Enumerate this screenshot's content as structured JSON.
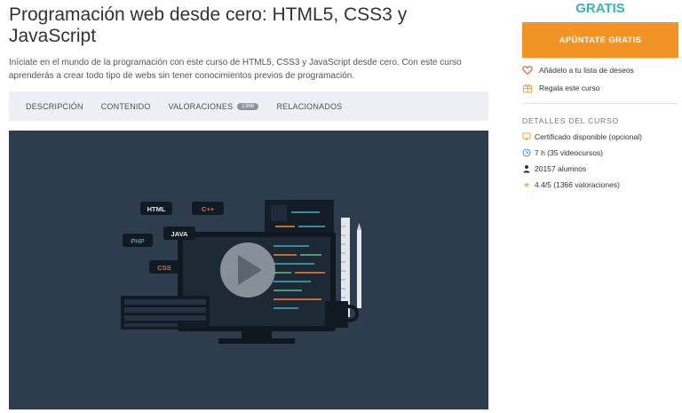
{
  "course": {
    "title": "Programación web desde cero: HTML5, CSS3 y JavaScript",
    "description": "Iníciate en el mundo de la programación con este curso de HTML5, CSS3 y JavaScript desde cero. Con este curso aprenderás a crear todo tipo de webs sin tener conocimientos previos de programación."
  },
  "tabs": [
    {
      "label": "Descripción"
    },
    {
      "label": "Contenido"
    },
    {
      "label": "Valoraciones",
      "badge": "1366"
    },
    {
      "label": "Relacionados"
    }
  ],
  "video": {
    "tags": [
      "HTML",
      "C++",
      "JAVA",
      "PHP",
      "CSS"
    ],
    "play_icon": "play-icon"
  },
  "sidebar": {
    "price": "GRATIS",
    "cta_label": "APÚNTATE GRATIS",
    "wishlist_label": "Añádelo a tu lista de deseos",
    "gift_label": "Regala este curso",
    "details_heading": "DETALLES DEL CURSO",
    "details": [
      {
        "icon": "certificate-icon",
        "text": "Certificado disponible (opcional)"
      },
      {
        "icon": "clock-icon",
        "text": "7 h (35 videocursos)"
      },
      {
        "icon": "user-icon",
        "text": "20157 alumnos"
      },
      {
        "icon": "star-icon",
        "text": "4.4/5 (1366 valoraciones)"
      }
    ]
  },
  "colors": {
    "accent": "#f39324",
    "price": "#3db4b0",
    "video_bg": "#2d3d4d",
    "tabs_bg": "#eef0f3"
  }
}
